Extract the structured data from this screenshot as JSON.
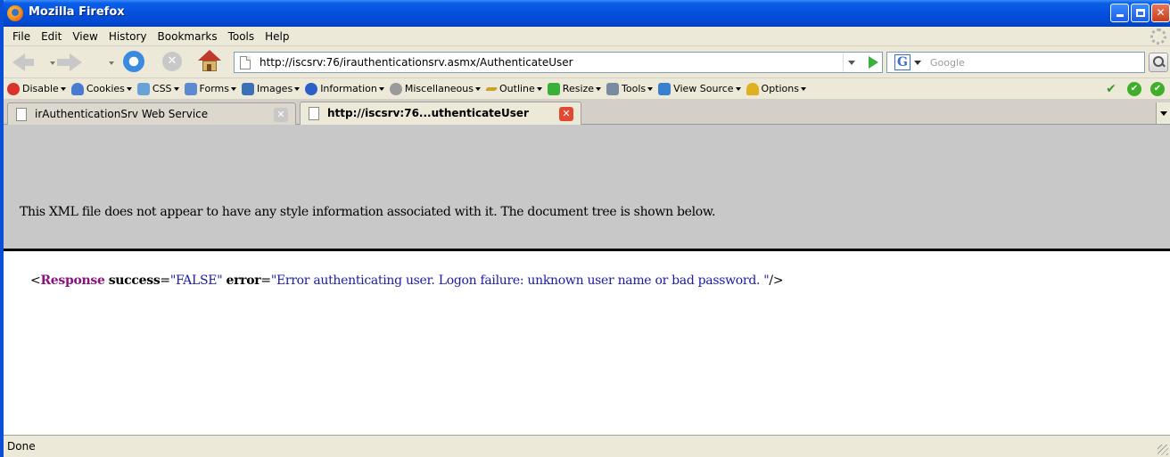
{
  "window": {
    "title": "Mozilla Firefox"
  },
  "menu": [
    "File",
    "Edit",
    "View",
    "History",
    "Bookmarks",
    "Tools",
    "Help"
  ],
  "nav": {
    "url": "http://iscsrv:76/irauthenticationsrv.asmx/AuthenticateUser",
    "search_placeholder": "Google",
    "search_engine_icon": "G"
  },
  "devtoolbar": {
    "items": [
      {
        "label": "Disable",
        "icon": "disable-icon",
        "color": "#d9342b"
      },
      {
        "label": "Cookies",
        "icon": "cookies-icon",
        "color": "#4a7bd0"
      },
      {
        "label": "CSS",
        "icon": "css-icon",
        "color": "#6aa2d8"
      },
      {
        "label": "Forms",
        "icon": "forms-icon",
        "color": "#5a8ad0"
      },
      {
        "label": "Images",
        "icon": "images-icon",
        "color": "#3a70b8"
      },
      {
        "label": "Information",
        "icon": "information-icon",
        "color": "#2a5fc8"
      },
      {
        "label": "Miscellaneous",
        "icon": "miscellaneous-icon",
        "color": "#9a9a9a"
      },
      {
        "label": "Outline",
        "icon": "outline-icon",
        "color": "#c8a030"
      },
      {
        "label": "Resize",
        "icon": "resize-icon",
        "color": "#3ab03a"
      },
      {
        "label": "Tools",
        "icon": "tools-icon",
        "color": "#7a8aa0"
      },
      {
        "label": "View Source",
        "icon": "view-source-icon",
        "color": "#3a80d0"
      },
      {
        "label": "Options",
        "icon": "options-icon",
        "color": "#e0b020"
      }
    ]
  },
  "tabs": [
    {
      "label": "irAuthenticationSrv Web Service",
      "active": false
    },
    {
      "label": "http://iscsrv:76...uthenticateUser",
      "active": true
    }
  ],
  "page": {
    "header_text": "This XML file does not appear to have any style information associated with it. The document tree is shown below.",
    "xml": {
      "open": "<",
      "tag": "Response",
      "attr1_name": "success",
      "attr1_value": "\"FALSE\"",
      "attr2_name": "error",
      "attr2_value": "\"Error authenticating user. Logon failure: unknown user name or bad password. \"",
      "close": "/>",
      "eq": "="
    }
  },
  "status": {
    "text": "Done"
  }
}
